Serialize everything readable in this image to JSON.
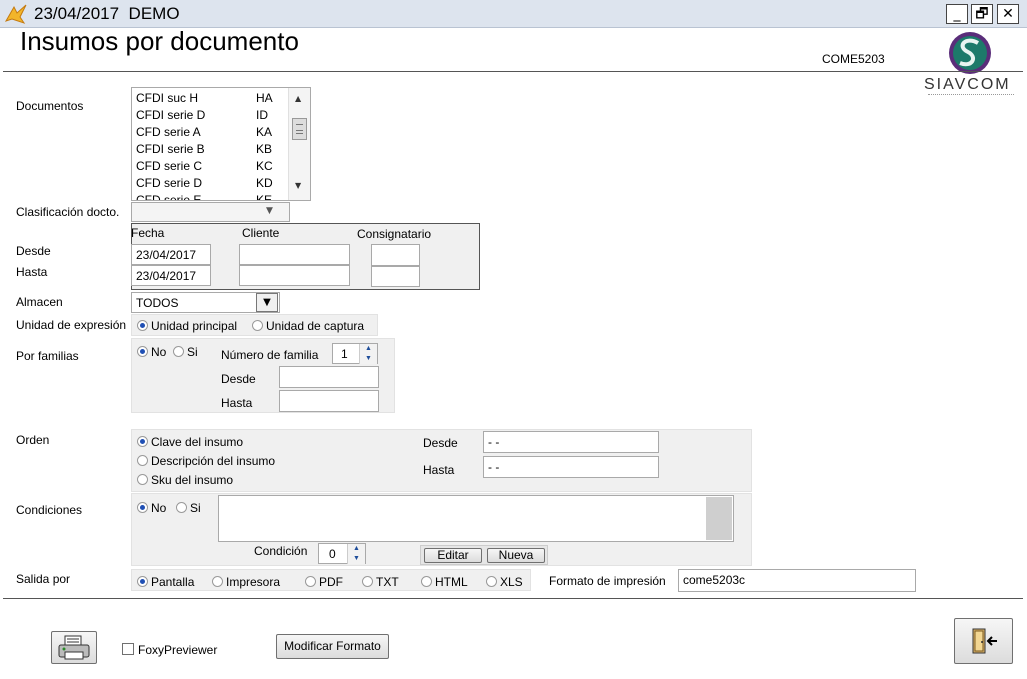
{
  "window": {
    "title_date": "23/04/2017",
    "title_mode": "DEMO",
    "controls": {
      "minimize": "_",
      "restore": "🗗",
      "close": "✕"
    }
  },
  "page": {
    "heading": "Insumos por documento",
    "code": "COME5203",
    "logo_text": "SIAVCOM"
  },
  "documentos": {
    "label": "Documentos",
    "items": [
      {
        "name": "CFDI  suc  H",
        "code": "HA"
      },
      {
        "name": "CFDI  serie D",
        "code": "ID"
      },
      {
        "name": "CFD serie A",
        "code": "KA"
      },
      {
        "name": "CFDI serie B",
        "code": "KB"
      },
      {
        "name": "CFD serie C",
        "code": "KC"
      },
      {
        "name": "CFD serie D",
        "code": "KD"
      },
      {
        "name": "CFD serie E",
        "code": "KE"
      }
    ]
  },
  "clasificacion": {
    "label": "Clasificación docto.",
    "value": ""
  },
  "rango": {
    "col_fecha": "Fecha",
    "col_cliente": "Cliente",
    "col_consignatario": "Consignatario",
    "desde_label": "Desde",
    "hasta_label": "Hasta",
    "fecha_desde": "23/04/2017",
    "fecha_hasta": "23/04/2017",
    "cliente_desde": "",
    "cliente_hasta": "",
    "consig_desde": "",
    "consig_hasta": ""
  },
  "almacen": {
    "label": "Almacen",
    "value": "TODOS"
  },
  "unidad": {
    "label": "Unidad de expresión",
    "opt1": "Unidad principal",
    "opt2": "Unidad de captura",
    "selected": "opt1"
  },
  "familias": {
    "label": "Por familias",
    "no": "No",
    "si": "Si",
    "selected": "no",
    "numero_label": "Número de familia",
    "numero_value": "1",
    "desde_label": "Desde",
    "hasta_label": "Hasta",
    "desde_value": "",
    "hasta_value": ""
  },
  "orden": {
    "label": "Orden",
    "opt1": "Clave del insumo",
    "opt2": "Descripción del insumo",
    "opt3": "Sku del insumo",
    "selected": "opt1",
    "desde_label": "Desde",
    "hasta_label": "Hasta",
    "desde_value": " - -",
    "hasta_value": " - -"
  },
  "condiciones": {
    "label": "Condiciones",
    "no": "No",
    "si": "Si",
    "selected": "no",
    "condicion_label": "Condición",
    "condicion_value": "0",
    "editar": "Editar",
    "nueva": "Nueva",
    "text": ""
  },
  "salida": {
    "label": "Salida por",
    "options": [
      "Pantalla",
      "Impresora",
      "PDF",
      "TXT",
      "HTML",
      "XLS"
    ],
    "selected": "Pantalla",
    "formato_label": "Formato de impresión",
    "formato_value": "come5203c"
  },
  "footer": {
    "foxy_label": "FoxyPreviewer",
    "foxy_checked": false,
    "modificar": "Modificar Formato"
  },
  "colors": {
    "titlebar": "#dde4ee",
    "panel": "#f0f0f0",
    "radio_dot": "#1f4fb4"
  },
  "icons": [
    "app-icon",
    "printer-icon",
    "exit-door-icon",
    "siavcom-logo"
  ]
}
